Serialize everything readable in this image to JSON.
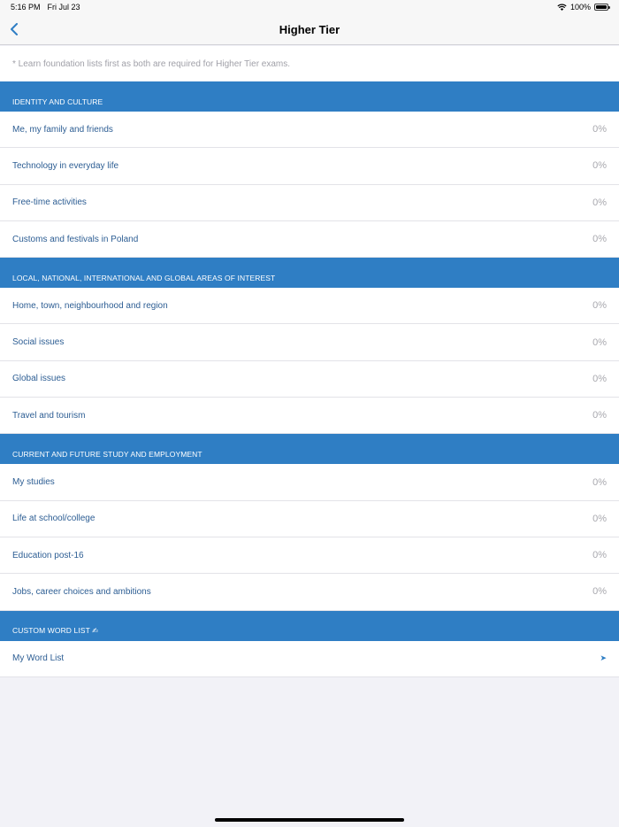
{
  "status": {
    "time": "5:16 PM",
    "date": "Fri Jul 23",
    "battery": "100%"
  },
  "nav": {
    "title": "Higher Tier"
  },
  "note": "* Learn foundation lists first as both are required for Higher Tier exams.",
  "sections": [
    {
      "title": "IDENTITY AND CULTURE",
      "items": [
        {
          "label": "Me, my family and friends",
          "value": "0%"
        },
        {
          "label": "Technology in everyday life",
          "value": "0%"
        },
        {
          "label": "Free-time activities",
          "value": "0%"
        },
        {
          "label": "Customs and festivals in Poland",
          "value": "0%"
        }
      ]
    },
    {
      "title": "LOCAL, NATIONAL, INTERNATIONAL AND GLOBAL AREAS OF INTEREST",
      "items": [
        {
          "label": "Home, town, neighbourhood and region",
          "value": "0%"
        },
        {
          "label": "Social issues",
          "value": "0%"
        },
        {
          "label": "Global issues",
          "value": "0%"
        },
        {
          "label": "Travel and tourism",
          "value": "0%"
        }
      ]
    },
    {
      "title": "CURRENT AND FUTURE STUDY AND EMPLOYMENT",
      "items": [
        {
          "label": "My studies",
          "value": "0%"
        },
        {
          "label": "Life at school/college",
          "value": "0%"
        },
        {
          "label": "Education post-16",
          "value": "0%"
        },
        {
          "label": "Jobs, career choices and ambitions",
          "value": "0%"
        }
      ]
    },
    {
      "title": "CUSTOM WORD LIST ✍",
      "items": [
        {
          "label": "My Word List",
          "value": "➤"
        }
      ]
    }
  ]
}
